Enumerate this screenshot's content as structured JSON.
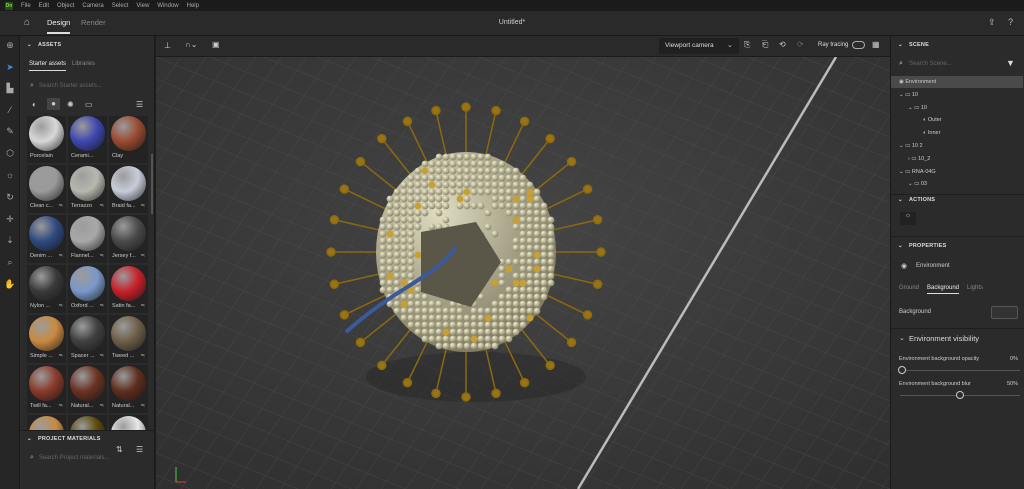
{
  "app": {
    "logo": "Dn",
    "menu": [
      "File",
      "Edit",
      "Object",
      "Camera",
      "Select",
      "View",
      "Window",
      "Help"
    ],
    "title": "Untitled*"
  },
  "tabs": {
    "design": "Design",
    "render": "Render"
  },
  "assets": {
    "header": "ASSETS",
    "tab_starter": "Starter assets",
    "tab_libraries": "Libraries",
    "search_placeholder": "Search Starter assets...",
    "materials": [
      {
        "label": "Porcelain",
        "color": "#d8d8d8"
      },
      {
        "label": "Cerami...",
        "color": "#3f47b0"
      },
      {
        "label": "Clay",
        "color": "#9a4a32"
      },
      {
        "label": "Clean c...",
        "color": "#9a9a9a"
      },
      {
        "label": "Terrazzo",
        "color": "#b8b8b0"
      },
      {
        "label": "Braid fa...",
        "color": "#c8ccd8"
      },
      {
        "label": "Denim ...",
        "color": "#2f4a80"
      },
      {
        "label": "Flannel...",
        "color": "#a8a8a8"
      },
      {
        "label": "Jersey f...",
        "color": "#4a4a4c"
      },
      {
        "label": "Nylon ...",
        "color": "#3a3a3a"
      },
      {
        "label": "Oxford ...",
        "color": "#7a98c8"
      },
      {
        "label": "Satin fa...",
        "color": "#c8202a"
      },
      {
        "label": "Simple ...",
        "color": "#c88a40"
      },
      {
        "label": "Spacer ...",
        "color": "#404042"
      },
      {
        "label": "Tweed ...",
        "color": "#6e5e48"
      },
      {
        "label": "Twill fa...",
        "color": "#8a3a2a"
      },
      {
        "label": "Natural...",
        "color": "#6a3222"
      },
      {
        "label": "Natural...",
        "color": "#5e2e1e"
      },
      {
        "label": "",
        "color": "#c88a40"
      },
      {
        "label": "",
        "color": "#5a4a08"
      },
      {
        "label": "",
        "color": "#e8e8e8"
      }
    ],
    "project_header": "PROJECT MATERIALS",
    "project_search_placeholder": "Search Project materials..."
  },
  "viewport": {
    "camera": "Viewport camera",
    "ray_tracing": "Ray tracing"
  },
  "scene": {
    "header": "SCENE",
    "search_placeholder": "Search Scene...",
    "tree": [
      {
        "label": "Environment",
        "icon": "environment",
        "depth": 0,
        "selected": true
      },
      {
        "label": "10",
        "icon": "folder",
        "depth": 0
      },
      {
        "label": "10",
        "icon": "folder",
        "depth": 1
      },
      {
        "label": "Outer",
        "icon": "material",
        "depth": 2
      },
      {
        "label": "Inner",
        "icon": "material",
        "depth": 2
      },
      {
        "label": "10 2",
        "icon": "folder",
        "depth": 0
      },
      {
        "label": "10_2",
        "icon": "folder",
        "depth": 1
      },
      {
        "label": "RNA-04G",
        "icon": "folder",
        "depth": 0
      },
      {
        "label": "03",
        "icon": "folder",
        "depth": 1
      }
    ]
  },
  "actions": {
    "header": "ACTIONS"
  },
  "properties": {
    "header": "PROPERTIES",
    "object": "Environment",
    "tabs": [
      "Ground",
      "Background",
      "Lights"
    ],
    "active_tab": "Background",
    "background_label": "Background",
    "section": "Environment visibility",
    "opacity_label": "Environment background opacity",
    "opacity_value": "0%",
    "opacity": 0,
    "blur_label": "Environment background blur",
    "blur_value": "50%",
    "blur": 50
  }
}
